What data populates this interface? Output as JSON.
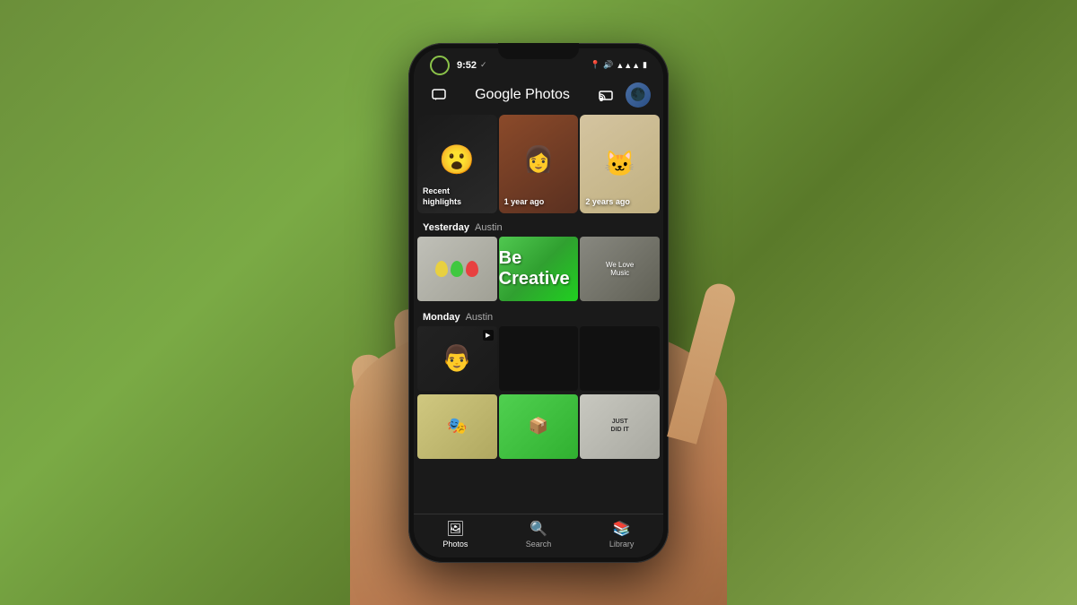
{
  "background": {
    "description": "outdoor grass background"
  },
  "status_bar": {
    "time": "9:52",
    "checkmark": "✓",
    "icons": [
      "📍",
      "🔊",
      "📶",
      "🔋"
    ]
  },
  "header": {
    "title": "Google Photos",
    "left_icon": "message-square",
    "cast_icon": "cast",
    "avatar_text": "👤"
  },
  "highlights": [
    {
      "label": "Recent\nhighlights",
      "bg_class": "card-bg-1",
      "emoji": "😮"
    },
    {
      "label": "1 year ago",
      "bg_class": "card-bg-2",
      "emoji": "👩"
    },
    {
      "label": "2 years ago",
      "bg_class": "card-bg-3",
      "emoji": "🐱"
    }
  ],
  "sections": [
    {
      "date": "Yesterday",
      "location": "Austin",
      "photos": [
        {
          "color_class": "pc1",
          "type": "balloon"
        },
        {
          "color_class": "pc2",
          "type": "balloon"
        },
        {
          "color_class": "pc3",
          "type": "balloon"
        }
      ]
    },
    {
      "date": "Monday",
      "location": "Austin",
      "photos": [
        {
          "color_class": "pc4",
          "type": "portrait",
          "has_video": true
        },
        {
          "color_class": "pc5",
          "type": "normal"
        },
        {
          "color_class": "pc6",
          "type": "normal"
        }
      ]
    }
  ],
  "monday_bottom_row": [
    {
      "color_class": "pc1",
      "type": "sticker"
    },
    {
      "color_class": "pc2",
      "type": "sticker_green"
    },
    {
      "color_class": "pc3",
      "type": "sticker_sign"
    }
  ],
  "nav": {
    "items": [
      {
        "icon": "🖼",
        "label": "Photos",
        "active": true
      },
      {
        "icon": "🔍",
        "label": "Search",
        "active": false
      },
      {
        "icon": "📚",
        "label": "Library",
        "active": false
      }
    ]
  }
}
